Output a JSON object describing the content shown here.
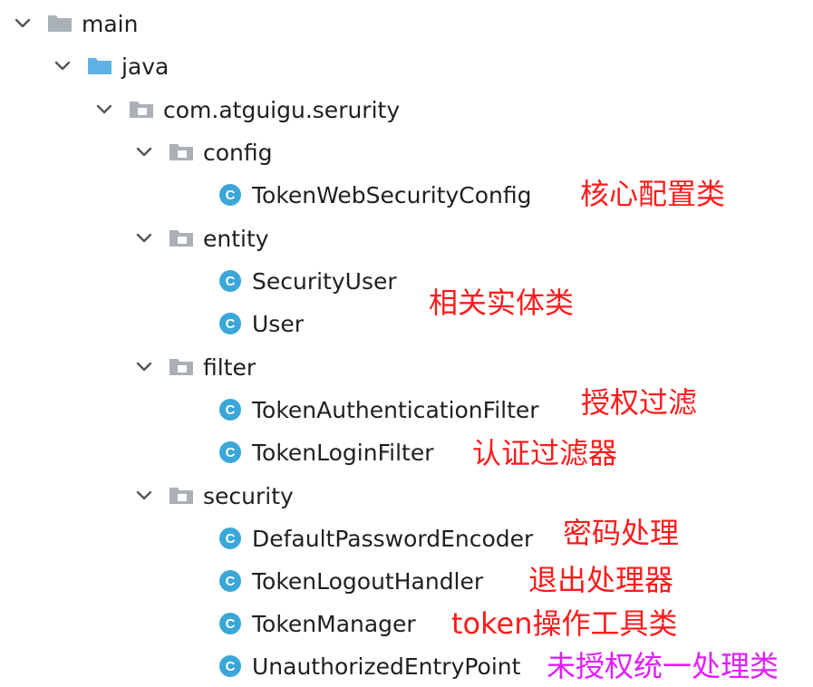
{
  "tree": [
    {
      "label": "main"
    },
    {
      "label": "java"
    },
    {
      "label": "com.atguigu.serurity"
    },
    {
      "label": "config"
    },
    {
      "label": "TokenWebSecurityConfig"
    },
    {
      "label": "entity"
    },
    {
      "label": "SecurityUser"
    },
    {
      "label": "User"
    },
    {
      "label": "filter"
    },
    {
      "label": "TokenAuthenticationFilter"
    },
    {
      "label": "TokenLoginFilter"
    },
    {
      "label": "security"
    },
    {
      "label": "DefaultPasswordEncoder"
    },
    {
      "label": "TokenLogoutHandler"
    },
    {
      "label": "TokenManager"
    },
    {
      "label": "UnauthorizedEntryPoint"
    }
  ],
  "notes": [
    {
      "text": "核心配置类"
    },
    {
      "text": "相关实体类"
    },
    {
      "text": "授权过滤"
    },
    {
      "text": "认证过滤器"
    },
    {
      "text": "密码处理"
    },
    {
      "text": "退出处理器"
    },
    {
      "text": "token操作工具类"
    },
    {
      "text": "未授权统一处理类"
    }
  ],
  "icons": {
    "chevron": "chevron-down-icon",
    "folder": "folder-icon",
    "source_folder": "source-folder-icon",
    "package": "package-icon",
    "class": "class-icon"
  },
  "colors": {
    "text": "#1f1f1f",
    "chevron": "#555555",
    "folder_gray": "#a9b1b7",
    "folder_blue": "#5fb2e5",
    "class_circle": "#3aa7d8",
    "note_red": "#ff1a1a",
    "note_magenta": "#e11cff"
  }
}
